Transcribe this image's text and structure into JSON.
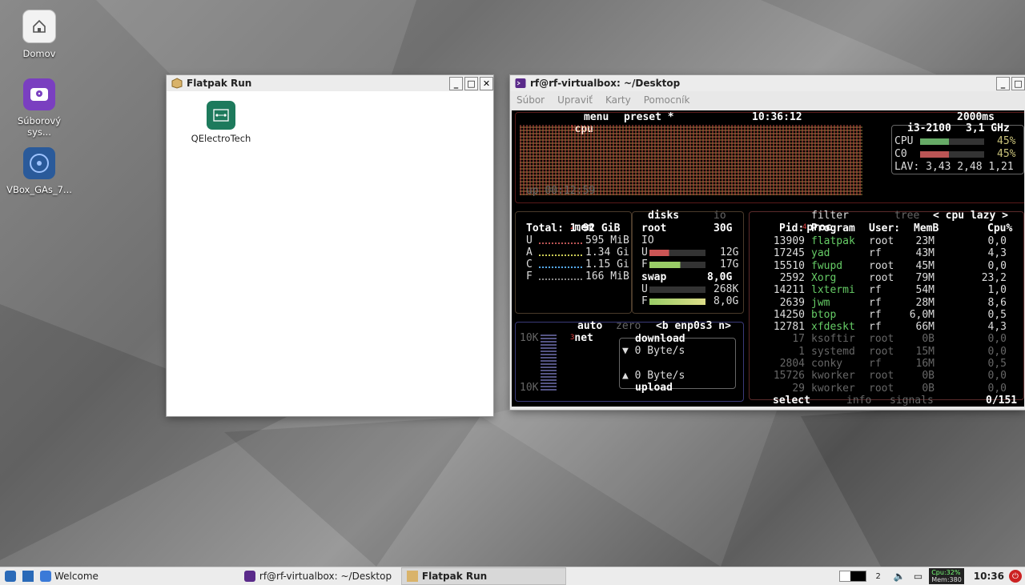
{
  "desktop": {
    "icons": [
      {
        "label": "Domov"
      },
      {
        "label": "Súborový sys..."
      },
      {
        "label": "VBox_GAs_7..."
      }
    ]
  },
  "flatpak_window": {
    "title": "Flatpak Run",
    "app_label": "QElectroTech"
  },
  "terminal_window": {
    "title": "rf@rf-virtualbox: ~/Desktop",
    "menu": [
      "Súbor",
      "Upraviť",
      "Karty",
      "Pomocník"
    ],
    "btop": {
      "cpu_box": {
        "tab_num": "1",
        "tab": "cpu",
        "menu": "menu",
        "preset": "preset *",
        "clock": "10:36:12",
        "interval": "2000ms",
        "model": "i3-2100",
        "freq": "3,1 GHz",
        "cpu_label": "CPU",
        "cpu_pct": "45%",
        "c0_label": "C0",
        "c0_pct": "45%",
        "lav": "LAV: 3,43 2,48 1,21",
        "uptime": "up 00:12:59"
      },
      "mem_box": {
        "tab_num": "2",
        "tab": "mem",
        "disks_tab": "disks",
        "io_tab": "io",
        "total": "Total: 1.92 GiB",
        "rows": [
          {
            "k": "U",
            "v": "595 MiB"
          },
          {
            "k": "A",
            "v": "1.34 Gi"
          },
          {
            "k": "C",
            "v": "1.15 Gi"
          },
          {
            "k": "F",
            "v": "166 MiB"
          }
        ],
        "root_label": "root",
        "root_size": "30G",
        "io_label": "IO",
        "root_u": "12G",
        "root_f": "17G",
        "swap_label": "swap",
        "swap_size": "8,0G",
        "swap_u": "268K",
        "swap_f": "8,0G"
      },
      "net_box": {
        "tab_num": "3",
        "tab": "net",
        "auto": "auto",
        "zero": "zero",
        "iface": "<b enp0s3 n>",
        "scale_top": "10K",
        "scale_bottom": "10K",
        "download_label": "download",
        "download_val": "▼ 0 Byte/s",
        "upload_val": "▲ 0 Byte/s",
        "upload_label": "upload"
      },
      "proc_box": {
        "tab_num": "4",
        "tab": "proc",
        "filter": "filter",
        "tree": "tree",
        "sort": "< cpu lazy >",
        "headers": [
          "Pid:",
          "Program",
          "User:",
          "MemB",
          "Cpu%"
        ],
        "rows": [
          {
            "pid": "13909",
            "prog": "flatpak",
            "user": "root",
            "mem": "23M",
            "cpu": "0,0"
          },
          {
            "pid": "17245",
            "prog": "yad",
            "user": "rf",
            "mem": "43M",
            "cpu": "4,3"
          },
          {
            "pid": "15510",
            "prog": "fwupd",
            "user": "root",
            "mem": "45M",
            "cpu": "0,0"
          },
          {
            "pid": "2592",
            "prog": "Xorg",
            "user": "root",
            "mem": "79M",
            "cpu": "23,2"
          },
          {
            "pid": "14211",
            "prog": "lxtermi",
            "user": "rf",
            "mem": "54M",
            "cpu": "1,0"
          },
          {
            "pid": "2639",
            "prog": "jwm",
            "user": "rf",
            "mem": "28M",
            "cpu": "8,6"
          },
          {
            "pid": "14250",
            "prog": "btop",
            "user": "rf",
            "mem": "6,0M",
            "cpu": "0,5"
          },
          {
            "pid": "12781",
            "prog": "xfdeskt",
            "user": "rf",
            "mem": "66M",
            "cpu": "4,3"
          },
          {
            "pid": "17",
            "prog": "ksoftir",
            "user": "root",
            "mem": "0B",
            "cpu": "0,0"
          },
          {
            "pid": "1",
            "prog": "systemd",
            "user": "root",
            "mem": "15M",
            "cpu": "0,0"
          },
          {
            "pid": "2804",
            "prog": "conky",
            "user": "rf",
            "mem": "16M",
            "cpu": "0,5"
          },
          {
            "pid": "15726",
            "prog": "kworker",
            "user": "root",
            "mem": "0B",
            "cpu": "0,0"
          },
          {
            "pid": "29",
            "prog": "kworker",
            "user": "root",
            "mem": "0B",
            "cpu": "0,0"
          }
        ],
        "footer_select": "select",
        "footer_info": "info",
        "footer_signals": "signals",
        "footer_count": "0/151"
      }
    }
  },
  "taskbar": {
    "welcome": "Welcome",
    "tasks": [
      {
        "label": "rf@rf-virtualbox: ~/Desktop"
      },
      {
        "label": "Flatpak Run"
      }
    ],
    "workspace": "2",
    "monitor_cpu": "Cpu:32%",
    "monitor_mem": "Mem:380",
    "clock": "10:36"
  }
}
